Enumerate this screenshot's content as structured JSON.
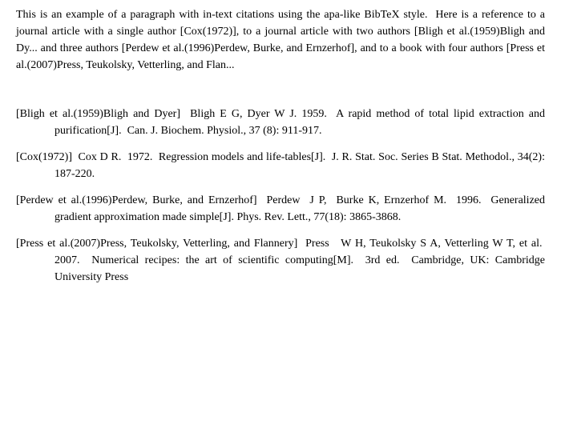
{
  "paragraph": {
    "text": "This is an example of a paragraph with in-text citations using the apa-like BibTeX style.  Here is a reference to a journal article with a single author [Cox(1972)], to a journal article with two authors [Bligh et al.(1959)Bligh and Dy... and three authors [Perdew et al.(1996)Perdew, Burke, and Ernzerhof], and to a book with four authors [Press et al.(2007)Press, Teukolsky, Vetterling, and Flan..."
  },
  "references": [
    {
      "id": "bligh1959",
      "key": "[Bligh et al.(1959)Bligh and Dyer]",
      "full": "[Bligh et al.(1959)Bligh and Dyer]  Bligh E G, Dyer W J. 1959.  A rapid method of total lipid extraction and purification[J].  Can. J. Biochem. Physiol., 37 (8): 911-917."
    },
    {
      "id": "cox1972",
      "key": "[Cox(1972)]",
      "full": "[Cox(1972)]  Cox D R.  1972.  Regression models and life-tables[J].  J. R. Stat. Soc. Series B Stat. Methodol., 34(2): 187-220."
    },
    {
      "id": "perdew1996",
      "key": "[Perdew et al.(1996)Perdew, Burke, and Ernzerhof]",
      "full": "[Perdew et al.(1996)Perdew, Burke, and Ernzerhof]  Perdew  J P,  Burke K, Ernzerhof M.  1996.  Generalized gradient approximation made simple[J]. Phys. Rev. Lett., 77(18): 3865-3868."
    },
    {
      "id": "press2007",
      "key": "[Press et al.(2007)Press, Teukolsky, Vetterling, and Flannery]",
      "full": "[Press et al.(2007)Press, Teukolsky, Vetterling, and Flannery]  Press   W H, Teukolsky S A, Vetterling W T, et al.  2007.  Numerical recipes: the art of scientific computing[M].  3rd ed.  Cambridge, UK: Cambridge University Press"
    }
  ]
}
